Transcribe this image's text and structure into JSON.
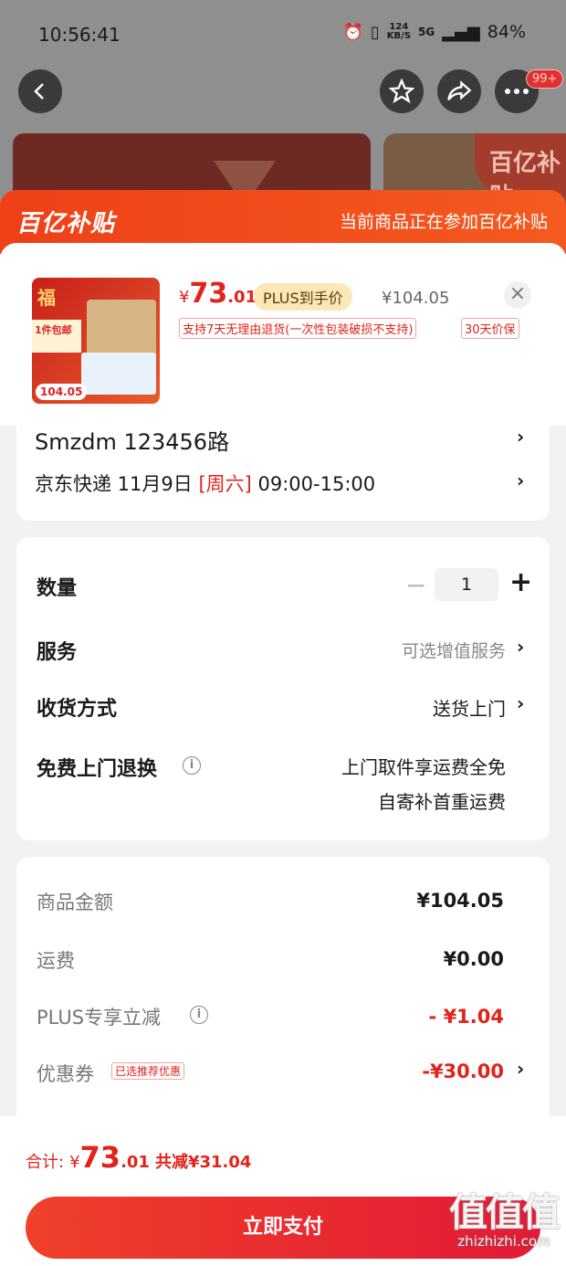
{
  "status_bar": {
    "time": "10:56:41",
    "net_speed_top": "124",
    "net_speed_bottom": "KB/S",
    "signal": "5G",
    "battery": "84%"
  },
  "background": {
    "more_badge": "99+"
  },
  "sheet": {
    "brand": "百亿补贴",
    "tip": "当前商品正在参加百亿补贴"
  },
  "product": {
    "price_yen": "¥",
    "price_int": "73",
    "price_dec": ".01",
    "plus_tag": "PLUS到手价",
    "original_price": "¥104.05",
    "tag_return": "支持7天无理由退货(一次性包装破损不支持)",
    "tag_price_protect": "30天价保",
    "thumb_price": "104.05"
  },
  "address": {
    "name": "Smzdm  123456路",
    "ship_prefix": "京东快递 11月9日 ",
    "ship_weekday": "[周六]",
    "ship_time": " 09:00-15:00"
  },
  "options": {
    "quantity_label": "数量",
    "quantity_value": "1",
    "service_label": "服务",
    "service_value": "可选增值服务",
    "delivery_label": "收货方式",
    "delivery_value": "送货上门",
    "return_label": "免费上门退换",
    "return_value_1": "上门取件享运费全免",
    "return_value_2": "自寄补首重运费"
  },
  "costs": {
    "goods_label": "商品金额",
    "goods_value": "¥104.05",
    "shipping_label": "运费",
    "shipping_value": "¥0.00",
    "plus_label": "PLUS专享立减",
    "plus_value": "- ¥1.04",
    "coupon_label": "优惠券",
    "coupon_tag": "已选推荐优惠",
    "coupon_value": "-¥30.00"
  },
  "bottom": {
    "total_label": "合计:",
    "total_yen": "¥",
    "total_int": "73",
    "total_dec": ".01",
    "discount_text": "共减¥31.04",
    "pay_button": "立即支付",
    "watermark_big": "值值值",
    "watermark_small": "zhizhizhi.com"
  },
  "colors": {
    "accent_red": "#e2231a",
    "header_orange": "#ef4018",
    "plus_gold": "#fbe8b6"
  }
}
